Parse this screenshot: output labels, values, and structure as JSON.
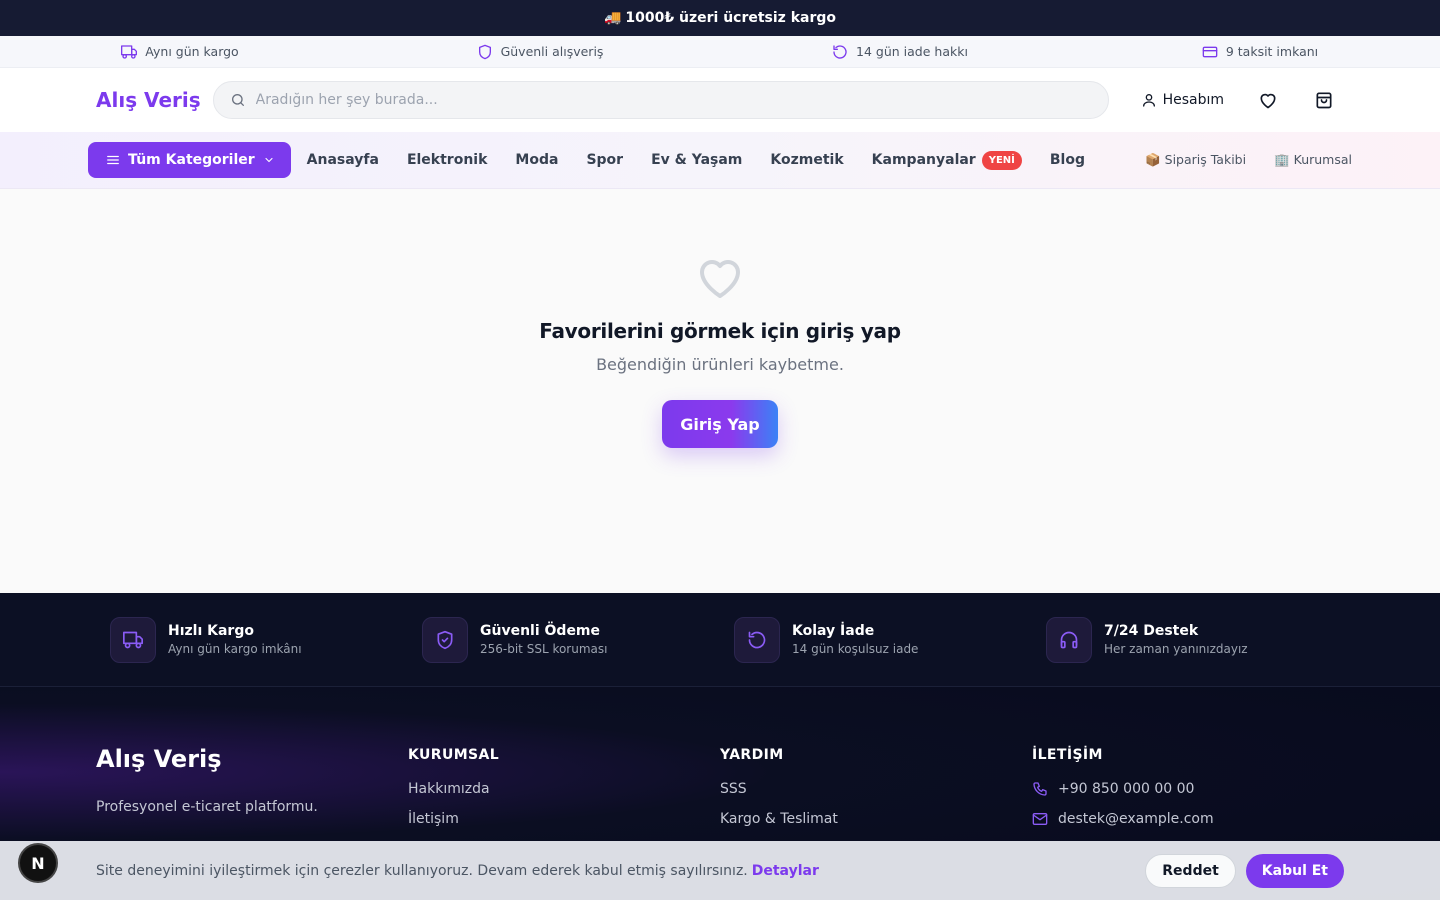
{
  "announcement": {
    "icon": "truck-emoji",
    "emoji": "🚚",
    "text": "1000₺ üzeri ücretsiz kargo"
  },
  "trust_bar": [
    {
      "icon": "truck-icon",
      "label": "Aynı gün kargo"
    },
    {
      "icon": "shield-icon",
      "label": "Güvenli alışveriş"
    },
    {
      "icon": "refresh-icon",
      "label": "14 gün iade hakkı"
    },
    {
      "icon": "credit-card-icon",
      "label": "9 taksit imkanı"
    }
  ],
  "header": {
    "logo": "Alış Veriş",
    "search_placeholder": "Aradığın her şey burada...",
    "account_label": "Hesabım"
  },
  "nav": {
    "categories_label": "Tüm Kategoriler",
    "links": [
      "Anasayfa",
      "Elektronik",
      "Moda",
      "Spor",
      "Ev & Yaşam",
      "Kozmetik",
      "Kampanyalar",
      "Blog"
    ],
    "new_badge": "YENİ",
    "order_tracking": "📦 Sipariş Takibi",
    "corporate": "🏢 Kurumsal"
  },
  "main": {
    "title": "Favorilerini görmek için giriş yap",
    "subtitle": "Beğendiğin ürünleri kaybetme.",
    "login_button": "Giriş Yap"
  },
  "features": [
    {
      "icon": "truck-icon",
      "title": "Hızlı Kargo",
      "subtitle": "Aynı gün kargo imkânı"
    },
    {
      "icon": "shield-check-icon",
      "title": "Güvenli Ödeme",
      "subtitle": "256-bit SSL koruması"
    },
    {
      "icon": "refresh-icon",
      "title": "Kolay İade",
      "subtitle": "14 gün koşulsuz iade"
    },
    {
      "icon": "headphones-icon",
      "title": "7/24 Destek",
      "subtitle": "Her zaman yanınızdayız"
    }
  ],
  "footer": {
    "brand": "Alış Veriş",
    "description": "Profesyonel e-ticaret platformu.",
    "corporate_heading": "KURUMSAL",
    "corporate_links": [
      "Hakkımızda",
      "İletişim"
    ],
    "help_heading": "YARDIM",
    "help_links": [
      "SSS",
      "Kargo & Teslimat"
    ],
    "contact_heading": "İLETİŞİM",
    "phone": "+90 850 000 00 00",
    "email": "destek@example.com"
  },
  "cookie": {
    "text": "Site deneyimini iyileştirmek için çerezler kullanıyoruz. Devam ederek kabul etmiş sayılırsınız.",
    "details_link": "Detaylar",
    "reject": "Reddet",
    "accept": "Kabul Et"
  },
  "devtools_badge": "N",
  "colors": {
    "accent": "#7c3aed",
    "dark": "#161b33",
    "badge": "#ef4444"
  }
}
